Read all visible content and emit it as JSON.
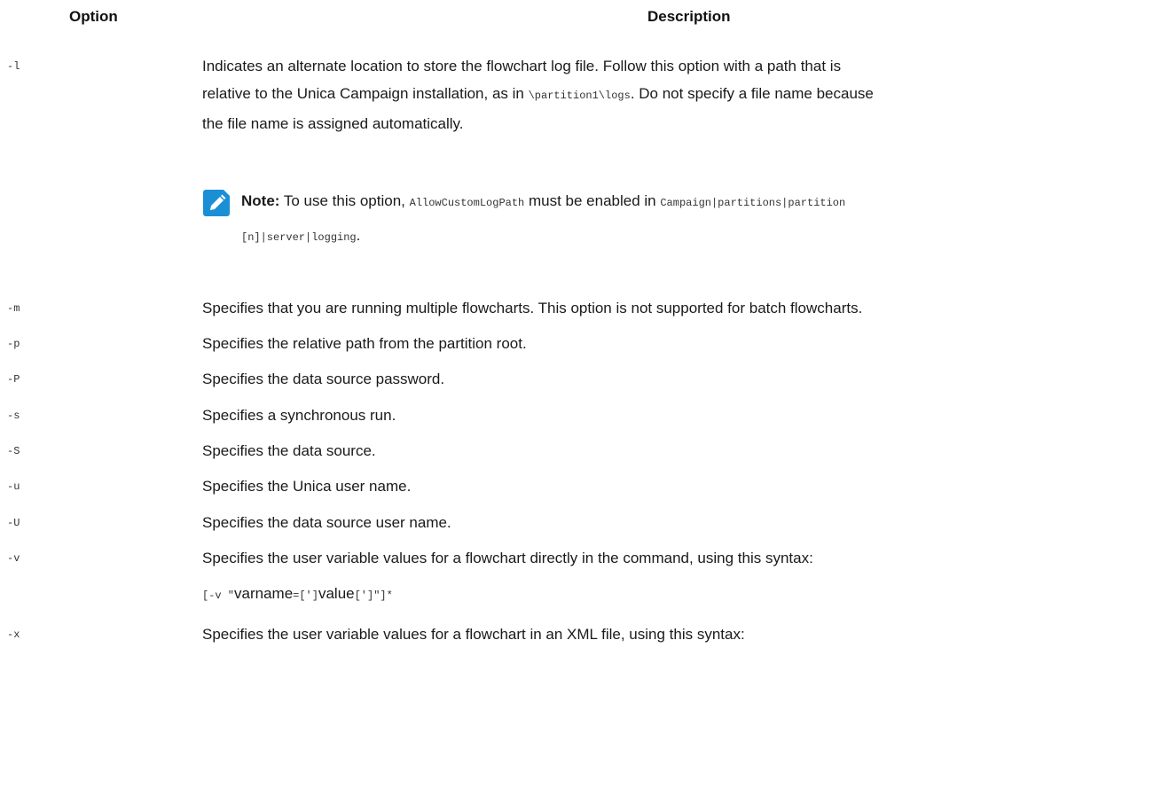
{
  "header": {
    "option": "Option",
    "description": "Description"
  },
  "row_l": {
    "option": "-l",
    "line1": "Indicates an alternate location to store the flowchart log file. Follow this option with a path that is",
    "line2_a": "relative to the Unica Campaign installation, as in ",
    "line2_code": "\\partition1\\logs",
    "line2_b": ". Do not specify a file name because",
    "line3": "the file name is assigned automatically."
  },
  "note": {
    "label": "Note:",
    "text_a": " To use this option, ",
    "code1": "AllowCustomLogPath",
    "text_b": " must be enabled in ",
    "code2": "Campaign|partitions|partition",
    "code3": "[n]|server|logging",
    "text_c": "."
  },
  "rows": [
    {
      "option": "-m",
      "description": "Specifies that you are running multiple flowcharts. This option is not supported for batch flowcharts."
    },
    {
      "option": "-p",
      "description": "Specifies the relative path from the partition root."
    },
    {
      "option": "-P",
      "description": "Specifies the data source password."
    },
    {
      "option": "-s",
      "description": "Specifies a synchronous run."
    },
    {
      "option": "-S",
      "description": "Specifies the data source."
    },
    {
      "option": "-u",
      "description": "Specifies the Unica user name."
    },
    {
      "option": "-U",
      "description": "Specifies the data source user name."
    },
    {
      "option": "-v",
      "description": "Specifies the user variable values for a flowchart directly in the command, using this syntax:"
    },
    {
      "option": "-x",
      "description": "Specifies the user variable values for a flowchart in an XML file, using this syntax:"
    }
  ],
  "syntax_v": {
    "code_a": "[-v \"",
    "word1": "varname",
    "code_b": "=[']",
    "word2": "value",
    "code_c": "[']\"]*"
  },
  "icon_color": "#1a8fd6"
}
